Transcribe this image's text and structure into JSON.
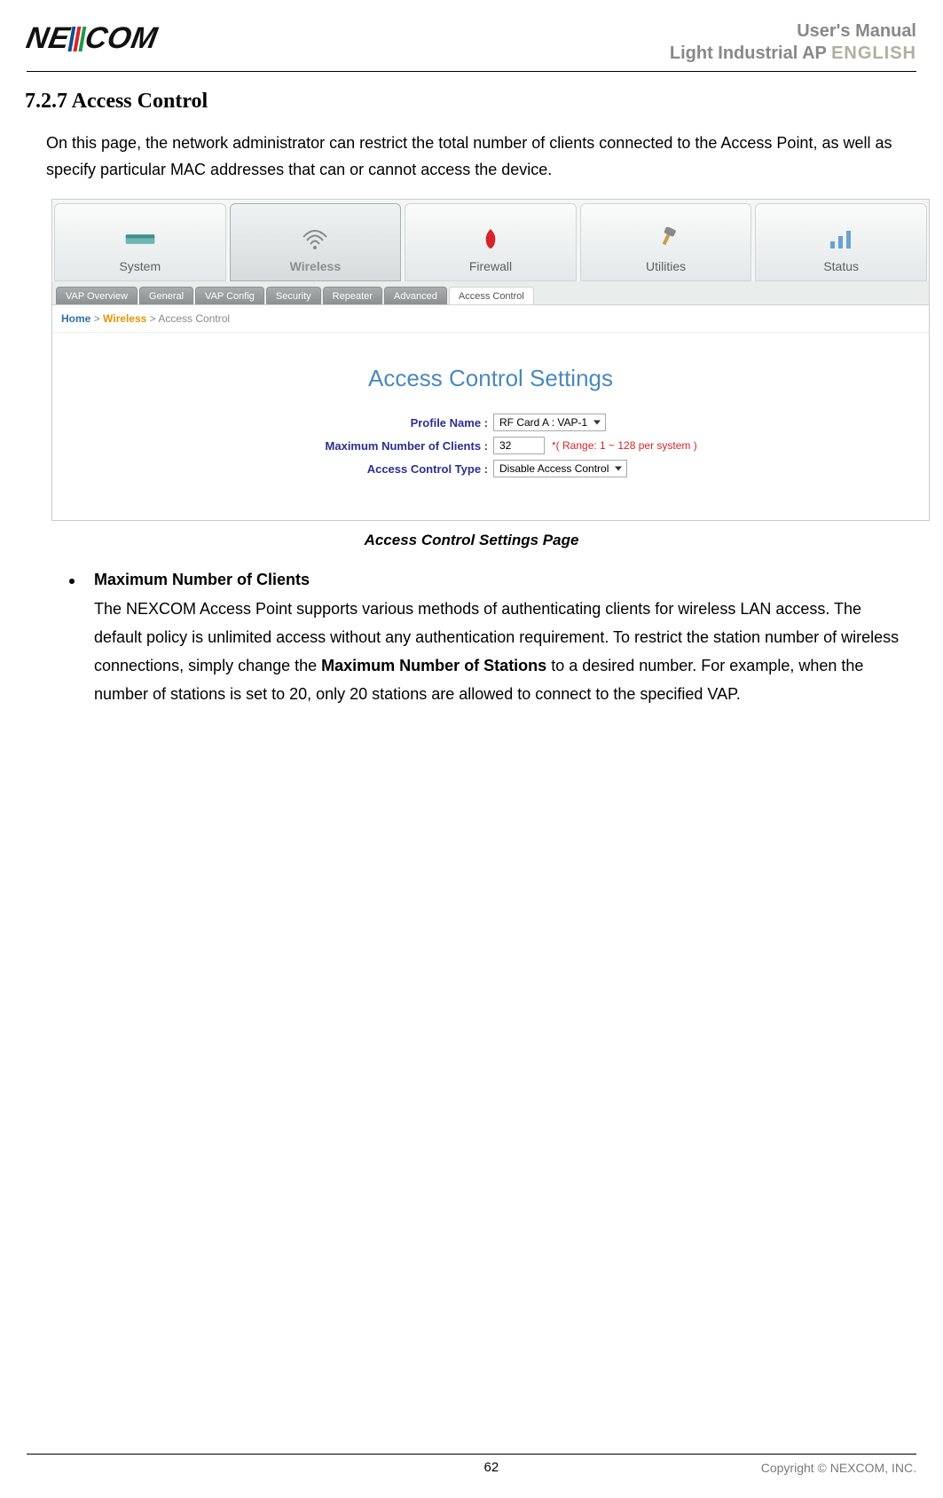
{
  "header": {
    "logo_left": "NE",
    "logo_right": "COM",
    "doc_title_line1": "User's Manual",
    "doc_title_line2": "Light Industrial AP",
    "doc_lang": "ENGLISH"
  },
  "section": {
    "heading": "7.2.7 Access Control",
    "intro": "On this page, the network administrator can restrict the total number of clients connected to the Access Point, as well as specify particular MAC addresses that can or cannot access the device."
  },
  "screenshot": {
    "main_tabs": [
      {
        "label": "System"
      },
      {
        "label": "Wireless",
        "active": true
      },
      {
        "label": "Firewall"
      },
      {
        "label": "Utilities"
      },
      {
        "label": "Status"
      }
    ],
    "sub_tabs": [
      {
        "label": "VAP Overview"
      },
      {
        "label": "General"
      },
      {
        "label": "VAP Config"
      },
      {
        "label": "Security"
      },
      {
        "label": "Repeater"
      },
      {
        "label": "Advanced"
      },
      {
        "label": "Access Control",
        "active": true
      }
    ],
    "breadcrumb": {
      "home": "Home",
      "sep1": ">",
      "wireless": "Wireless",
      "sep2": ">",
      "current": "Access Control"
    },
    "settings_title": "Access Control Settings",
    "form": {
      "profile_name": {
        "label": "Profile Name :",
        "value": "RF Card A : VAP-1"
      },
      "max_clients": {
        "label": "Maximum Number of Clients :",
        "value": "32",
        "hint": "*( Range: 1 ~ 128 per system )"
      },
      "control_type": {
        "label": "Access Control Type :",
        "value": "Disable Access Control"
      }
    },
    "caption": "Access Control Settings Page"
  },
  "bullet": {
    "title": "Maximum Number of Clients",
    "text_pre": "The NEXCOM Access Point supports various methods of authenticating clients for wireless LAN access. The default policy is unlimited access without any authentication requirement.  To restrict the station number of wireless connections, simply change the ",
    "text_strong": "Maximum Number of Stations",
    "text_post": " to a desired number.  For example, when the number of stations is set to 20, only 20 stations are allowed to connect to the specified VAP."
  },
  "footer": {
    "page_number": "62",
    "copyright": "Copyright © NEXCOM, INC."
  }
}
